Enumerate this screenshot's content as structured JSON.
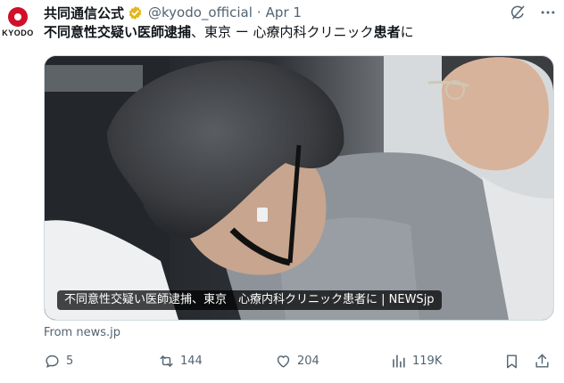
{
  "account": {
    "logo_text": "KYODO",
    "display_name": "共同通信公式",
    "handle": "@kyodo_official",
    "separator": "·",
    "date": "Apr 1"
  },
  "tweet": {
    "text_bold_1": "不同意性交疑い医師逮捕",
    "text_mid": "、東京 ー 心療内科クリニック",
    "text_bold_2": "患者",
    "text_end": "に"
  },
  "media": {
    "caption": "不同意性交疑い医師逮捕、東京　心療内科クリニック患者に | NEWSjp"
  },
  "source": {
    "label": "From news.jp"
  },
  "actions": {
    "replies": "5",
    "reposts": "144",
    "likes": "204",
    "views": "119K"
  },
  "icons": {
    "verified": "verified-badge-icon",
    "grok": "grok-icon",
    "more": "more-icon",
    "reply": "reply-icon",
    "repost": "repost-icon",
    "like": "like-icon",
    "views": "views-icon",
    "bookmark": "bookmark-icon",
    "share": "share-icon"
  },
  "colors": {
    "brand_red": "#d0102b",
    "verified_gold": "#e2b719",
    "muted": "#536471"
  }
}
